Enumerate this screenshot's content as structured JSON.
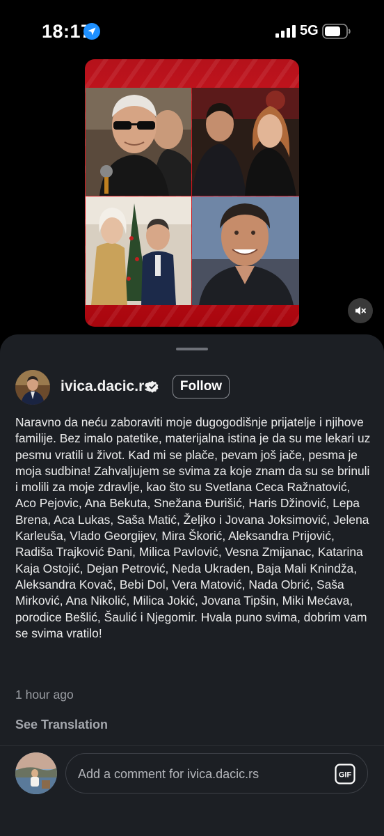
{
  "status_bar": {
    "time": "18:17",
    "network": "5G",
    "icons": [
      "location-icon",
      "signal-icon",
      "battery-icon"
    ]
  },
  "media": {
    "icons": [
      "mute-icon"
    ]
  },
  "post": {
    "username": "ivica.dacic.rs",
    "follow_label": "Follow",
    "caption": "Naravno da neću zaboraviti moje dugogodišnje prijatelje i njihove familije. Bez imalo patetike, materijalna istina je da su me lekari uz pesmu vratili u život. Kad mi se plače, pevam još jače, pesma je moja sudbina! Zahvaljujem se svima za koje znam da su se brinuli i molili za moje zdravlje, kao što su Svetlana Ceca Ražnatović, Aco Pejovic, Ana Bekuta, Snežana Đurišić, Haris Džinović, Lepa Brena, Aca Lukas, Saša Matić, Željko i Jovana Joksimović, Jelena Karleuša, Vlado Georgijev, Mira Škorić, Aleksandra Prijović, Radiša Trajković Đani, Milica Pavlović, Vesna Zmijanac, Katarina Kaja Ostojić, Dejan Petrović, Neda Ukraden, Baja Mali Knindža, Aleksandra Kovač, Bebi Dol, Vera Matović, Nada Obrić, Saša Mirković, Ana Nikolić, Milica Jokić, Jovana Tipšin, Miki Mećava, porodice Bešlić, Šaulić i Njegomir. Hvala puno svima, dobrim vam se svima vratilo!",
    "timestamp": "1 hour ago",
    "see_translation": "See Translation"
  },
  "comment": {
    "placeholder": "Add a comment for ivica.dacic.rs",
    "icons": [
      "gif-icon"
    ]
  },
  "colors": {
    "background": "#000000",
    "sheet": "#1c1f24",
    "text_primary": "#ececec",
    "text_secondary": "#9a9da3",
    "media_red": "#d91620"
  }
}
